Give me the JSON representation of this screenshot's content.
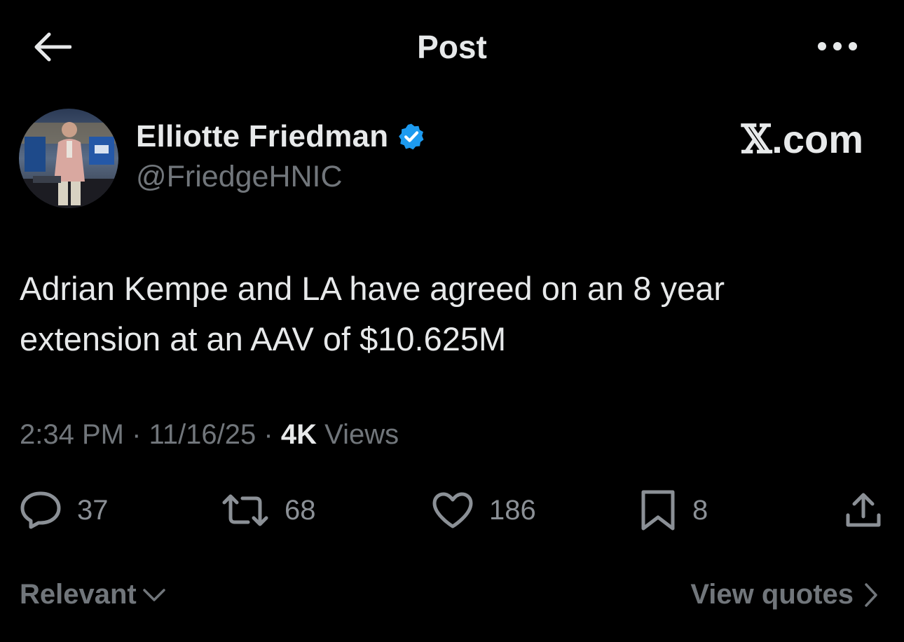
{
  "header": {
    "title": "Post",
    "back_icon": "arrow-left-icon",
    "more_icon": "more-horizontal-icon"
  },
  "author": {
    "name": "Elliotte Friedman",
    "handle": "@FriedgeHNIC",
    "verified": true,
    "verified_color": "#1d9bf0",
    "avatar_icon": "avatar-photo"
  },
  "brand": {
    "x_mark": "𝕏",
    "domain": ".com"
  },
  "post": {
    "text": "Adrian Kempe and LA have agreed on an 8 year extension at an AAV of $10.625M",
    "time": "2:34 PM",
    "separator": "·",
    "date": "11/16/25",
    "views_count": "4K",
    "views_label": "Views"
  },
  "actions": {
    "replies": "37",
    "reposts": "68",
    "likes": "186",
    "bookmarks": "8",
    "reply_icon": "reply-icon",
    "repost_icon": "repost-icon",
    "like_icon": "heart-icon",
    "bookmark_icon": "bookmark-icon",
    "share_icon": "share-icon"
  },
  "footer": {
    "sort_label": "Relevant",
    "view_quotes_label": "View quotes"
  },
  "colors": {
    "background": "#000000",
    "primary_text": "#e7e9ea",
    "secondary_text": "#71767b",
    "accent": "#1d9bf0"
  }
}
